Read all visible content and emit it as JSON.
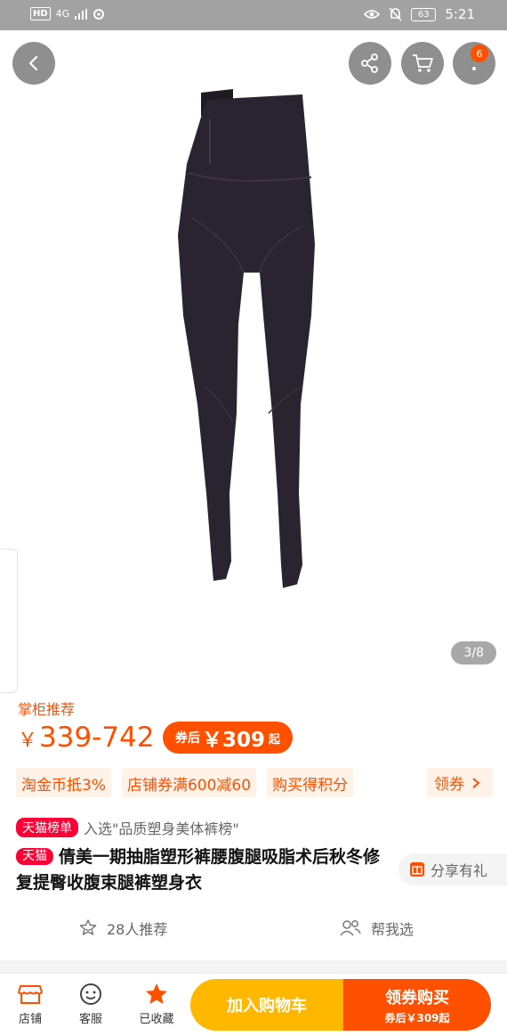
{
  "status_bar": {
    "hd": "HD",
    "network": "4G",
    "battery": "63",
    "time": "5:21"
  },
  "gallery": {
    "counter": "3/8",
    "cart_badge": "6",
    "icons": [
      "back-arrow-icon",
      "share-icon",
      "cart-icon",
      "more-icon"
    ]
  },
  "price": {
    "recommend_label": "掌柜推荐",
    "currency": "￥",
    "range": "339-742",
    "coupon_prefix": "券后",
    "coupon_price": "￥309",
    "coupon_suffix": "起"
  },
  "promos": [
    "淘金币抵3%",
    "店铺券满600减60",
    "购买得积分"
  ],
  "promo_more": "领券",
  "rank": {
    "tag": "天猫榜单",
    "text": "入选\"品质塑身美体裤榜\""
  },
  "title": {
    "tmall_tag": "天猫",
    "text": "倩美一期抽脂塑形裤腰腹腿吸脂术后秋冬修复提臀收腹束腿裤塑身衣"
  },
  "share_gift": "分享有礼",
  "actions": {
    "recommend": "28人推荐",
    "help_choose": "帮我选"
  },
  "bottom_bar": {
    "shop": "店铺",
    "service": "客服",
    "favorite": "已收藏",
    "add_to_cart": "加入购物车",
    "buy_title": "领券购买",
    "buy_sub": "券后￥309起"
  },
  "colors": {
    "accent": "#ff5000",
    "tmall_red": "#ff0036",
    "cart_yellow": "#ffb700"
  }
}
